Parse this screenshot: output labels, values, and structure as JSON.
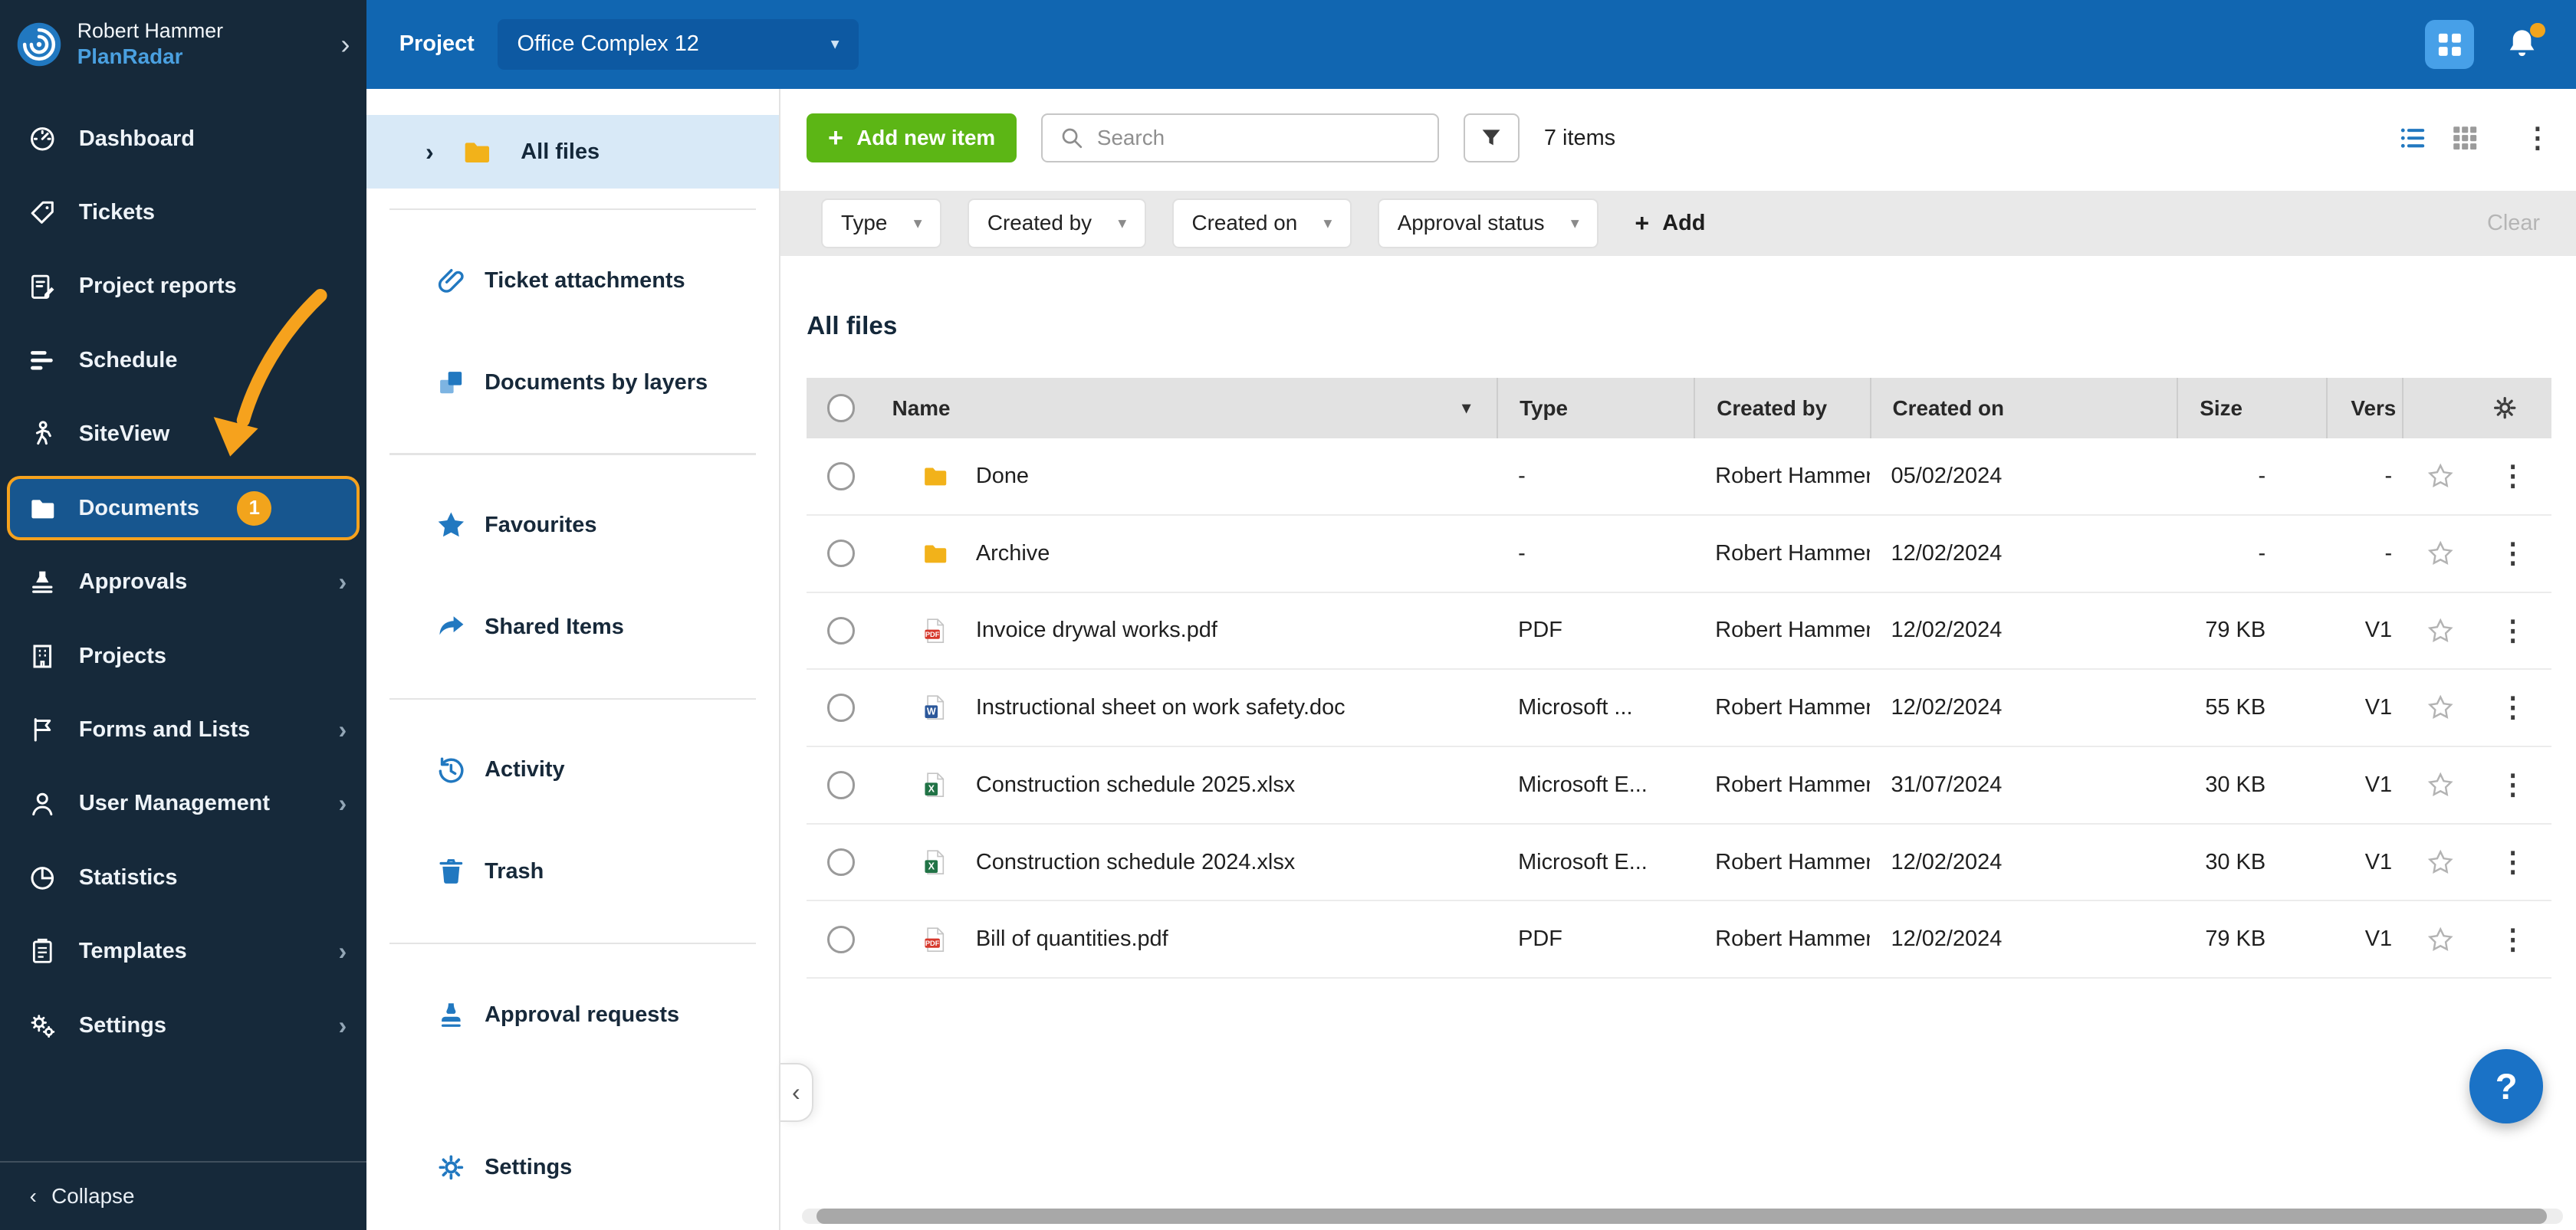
{
  "topbar": {
    "project_label": "Project",
    "project_value": "Office Complex 12"
  },
  "sidebar": {
    "user_name": "Robert Hammer",
    "brand": "PlanRadar",
    "collapse_label": "Collapse",
    "items": [
      {
        "label": "Dashboard",
        "icon": "dashboard"
      },
      {
        "label": "Tickets",
        "icon": "tickets"
      },
      {
        "label": "Project reports",
        "icon": "reports"
      },
      {
        "label": "Schedule",
        "icon": "schedule"
      },
      {
        "label": "SiteView",
        "icon": "siteview"
      },
      {
        "label": "Documents",
        "icon": "documents",
        "badge": "1",
        "active": true
      },
      {
        "label": "Approvals",
        "icon": "approvals",
        "has_submenu": true
      },
      {
        "label": "Projects",
        "icon": "projects"
      },
      {
        "label": "Forms and Lists",
        "icon": "forms",
        "has_submenu": true
      },
      {
        "label": "User Management",
        "icon": "users",
        "has_submenu": true
      },
      {
        "label": "Statistics",
        "icon": "statistics"
      },
      {
        "label": "Templates",
        "icon": "templates",
        "has_submenu": true
      },
      {
        "label": "Settings",
        "icon": "gears",
        "has_submenu": true
      }
    ]
  },
  "docnav": {
    "all_files_label": "All files",
    "items": [
      {
        "label": "Ticket attachments",
        "icon": "paperclip"
      },
      {
        "label": "Documents by layers",
        "icon": "layers"
      },
      {
        "label": "Favourites",
        "icon": "star-blue"
      },
      {
        "label": "Shared Items",
        "icon": "share"
      },
      {
        "label": "Activity",
        "icon": "history"
      },
      {
        "label": "Trash",
        "icon": "trash"
      },
      {
        "label": "Approval requests",
        "icon": "stamp"
      }
    ],
    "settings_label": "Settings"
  },
  "toolbar": {
    "add_button_label": "Add new item",
    "search_placeholder": "Search",
    "items_count": "7 items"
  },
  "filterbar": {
    "dropdowns": [
      {
        "label": "Type"
      },
      {
        "label": "Created by"
      },
      {
        "label": "Created on"
      },
      {
        "label": "Approval status"
      }
    ],
    "add_label": "Add",
    "clear_label": "Clear"
  },
  "content": {
    "title": "All files"
  },
  "table": {
    "columns": {
      "name": "Name",
      "type": "Type",
      "created_by": "Created by",
      "created_on": "Created on",
      "size": "Size",
      "version": "Vers"
    },
    "rows": [
      {
        "name": "Done",
        "file_icon": "folder",
        "type": "-",
        "created_by": "Robert Hammer",
        "created_on": "05/02/2024",
        "size": "-",
        "version": "-"
      },
      {
        "name": "Archive",
        "file_icon": "folder",
        "type": "-",
        "created_by": "Robert Hammer",
        "created_on": "12/02/2024",
        "size": "-",
        "version": "-"
      },
      {
        "name": "Invoice drywal works.pdf",
        "file_icon": "pdf",
        "type": "PDF",
        "created_by": "Robert Hammer",
        "created_on": "12/02/2024",
        "size": "79 KB",
        "version": "V1"
      },
      {
        "name": "Instructional sheet on work safety.doc",
        "file_icon": "word",
        "type": "Microsoft ...",
        "created_by": "Robert Hammer",
        "created_on": "12/02/2024",
        "size": "55 KB",
        "version": "V1"
      },
      {
        "name": "Construction schedule 2025.xlsx",
        "file_icon": "excel",
        "type": "Microsoft E...",
        "created_by": "Robert Hammer",
        "created_on": "31/07/2024",
        "size": "30 KB",
        "version": "V1"
      },
      {
        "name": "Construction schedule 2024.xlsx",
        "file_icon": "excel",
        "type": "Microsoft E...",
        "created_by": "Robert Hammer",
        "created_on": "12/02/2024",
        "size": "30 KB",
        "version": "V1"
      },
      {
        "name": "Bill of quantities.pdf",
        "file_icon": "pdf",
        "type": "PDF",
        "created_by": "Robert Hammer",
        "created_on": "12/02/2024",
        "size": "79 KB",
        "version": "V1"
      }
    ]
  },
  "help": {
    "label": "?"
  },
  "colors": {
    "topbar_blue": "#1166b1",
    "sidebar_navy": "#16293a",
    "accent_blue": "#2178c0",
    "annotation_orange": "#f6a21d",
    "green_button": "#5cb615",
    "selected_item_bg": "#d8e9f7",
    "folder_yellow": "#f2b21a",
    "pdf_red": "#d6382c",
    "word_blue": "#2b579a",
    "excel_green": "#217346"
  },
  "icons": {
    "plus": "+",
    "caret_down": "▾",
    "chevron_right": "›",
    "chevron_left": "‹",
    "kebab": "⋮",
    "sort_indicator": "▾",
    "search": "magnifier",
    "funnel": "filter-funnel",
    "bell": "notification-bell",
    "apps": "app-grid",
    "gear": "gear",
    "star": "star"
  }
}
